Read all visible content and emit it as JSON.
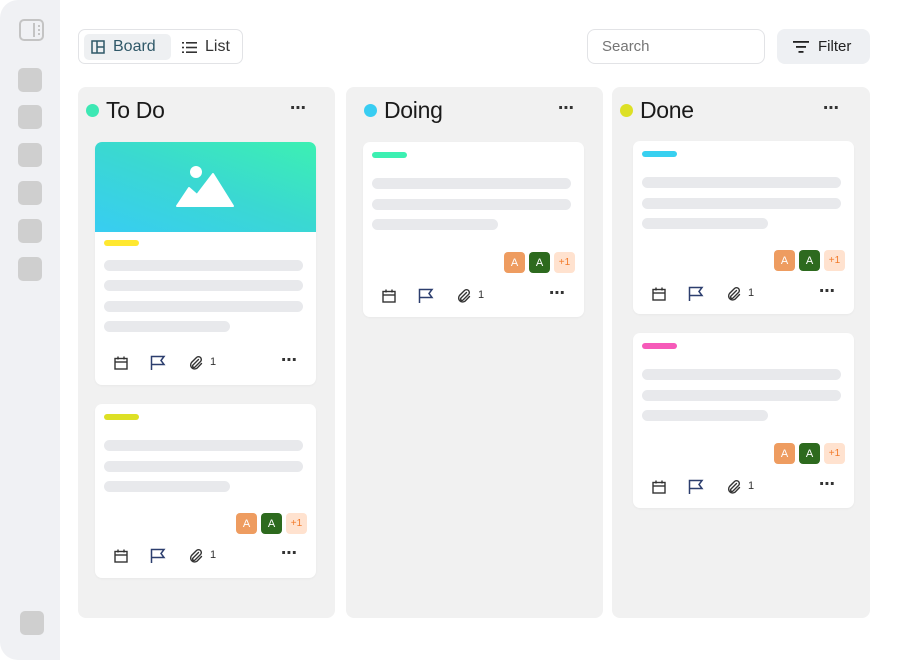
{
  "toolbar": {
    "view_tabs": [
      {
        "label": "Board",
        "icon": "board-icon",
        "active": true
      },
      {
        "label": "List",
        "icon": "list-icon",
        "active": false
      }
    ],
    "search_placeholder": "Search",
    "filter_label": "Filter"
  },
  "columns": [
    {
      "title": "To Do",
      "color": "#3de8b4",
      "more": "⋯",
      "cards": [
        {
          "image": "image-placeholder-icon",
          "tag_color": "#ffe830",
          "attachments": "1",
          "avatars": null
        },
        {
          "tag_color": "#dde025",
          "attachments": "1",
          "avatars": [
            "A",
            "A",
            "+1"
          ]
        }
      ]
    },
    {
      "title": "Doing",
      "color": "#38cdf2",
      "more": "⋯",
      "cards": [
        {
          "tag_color": "#3cf0b2",
          "attachments": "1",
          "avatars": [
            "A",
            "A",
            "+1"
          ]
        }
      ]
    },
    {
      "title": "Done",
      "color": "#dde025",
      "more": "⋯",
      "cards": [
        {
          "tag_color": "#38d0f0",
          "attachments": "1",
          "avatars": [
            "A",
            "A",
            "+1"
          ]
        },
        {
          "tag_color": "#f65ab9",
          "attachments": "1",
          "avatars": [
            "A",
            "A",
            "+1"
          ]
        }
      ]
    }
  ],
  "card_more": "⋯"
}
